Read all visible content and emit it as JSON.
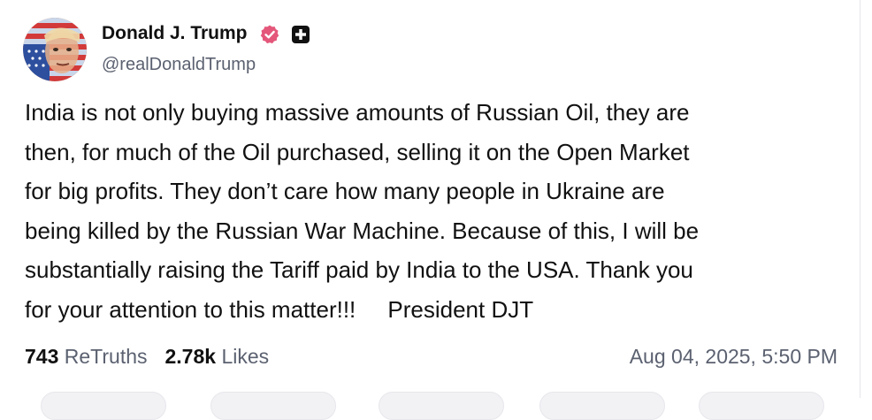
{
  "author": {
    "display_name": "Donald J. Trump",
    "handle": "@realDonaldTrump",
    "avatar_icon": "avatar-portrait-flag",
    "verified_icon": "verified-badge-icon",
    "verified_color": "#e4577b",
    "plus_icon": "plus-badge-icon"
  },
  "post": {
    "text": "India is not only buying massive amounts of Russian Oil, they are\nthen, for much of the Oil purchased, selling it on the Open Market\nfor big profits. They don’t care how many people in Ukraine are\nbeing killed by the Russian War Machine. Because of this, I will be\nsubstantially raising the Tariff paid by India to the USA. Thank you\nfor your attention to this matter!!!     President DJT"
  },
  "stats": {
    "retruths_count": "743",
    "retruths_label": "ReTruths",
    "likes_count": "2.78k",
    "likes_label": "Likes",
    "timestamp": "Aug 04, 2025, 5:50 PM"
  }
}
